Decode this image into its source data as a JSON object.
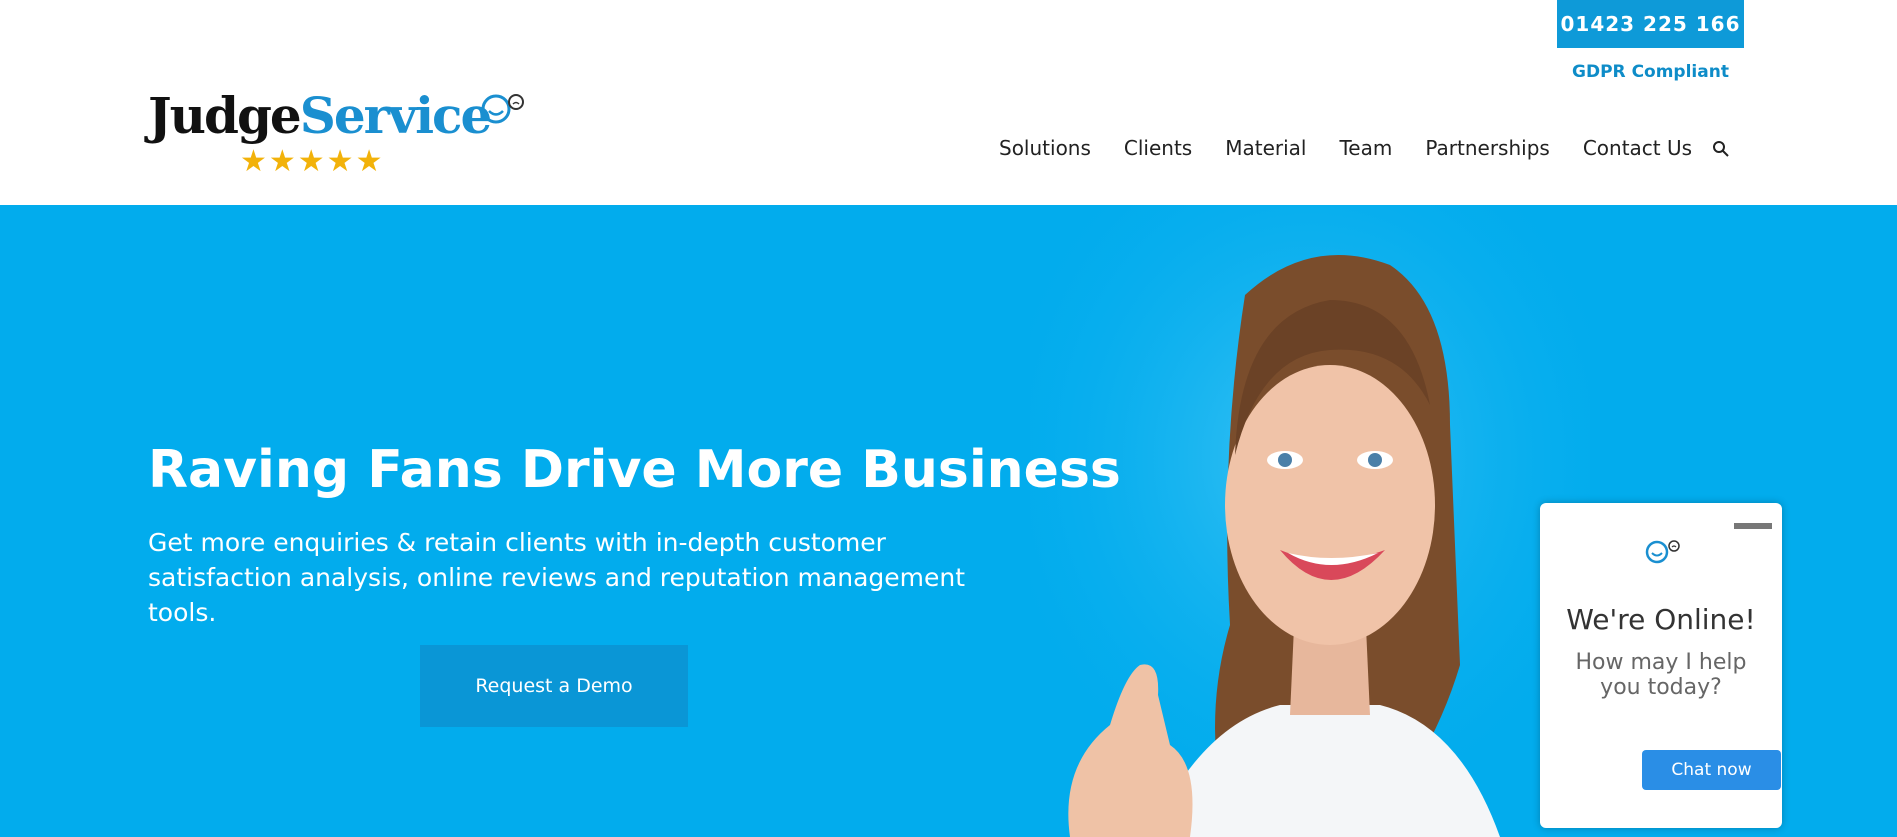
{
  "header": {
    "phone": "01423 225 166",
    "gdpr": "GDPR Compliant",
    "logo": {
      "part1": "Judge",
      "part2": "Service",
      "stars": "★★★★★"
    },
    "nav": [
      "Solutions",
      "Clients",
      "Material",
      "Team",
      "Partnerships",
      "Contact Us"
    ]
  },
  "hero": {
    "title": "Raving Fans Drive More Business",
    "subtitle": "Get more enquiries & retain clients with in-depth customer satisfaction analysis, online reviews and reputation management tools.",
    "cta": "Request a Demo"
  },
  "chat": {
    "title": "We're Online!",
    "subtitle": "How may I help you today?",
    "button": "Chat now"
  },
  "colors": {
    "brand_blue": "#02aced",
    "button_blue": "#0e9ad8",
    "star_gold": "#f2b20a",
    "chat_button": "#2a8ee6"
  }
}
